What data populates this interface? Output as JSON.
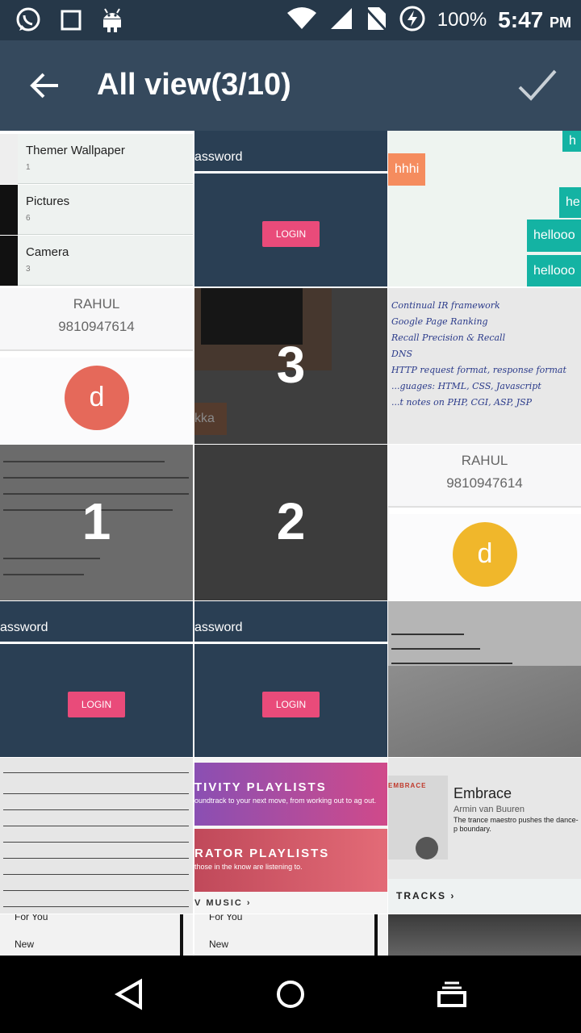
{
  "status_bar": {
    "battery": "100%",
    "time": "5:47",
    "ampm": "PM"
  },
  "app_bar": {
    "title": "All view(3/10)"
  },
  "thumbnails": {
    "folders": [
      {
        "name": "Themer Wallpaper",
        "count": "1"
      },
      {
        "name": "Pictures",
        "count": "6"
      },
      {
        "name": "Camera",
        "count": "3"
      }
    ],
    "password_label": "assword",
    "login_label": "LOGIN",
    "contact_name": "RAHUL",
    "contact_phone": "9810947614",
    "avatar_letter": "d",
    "chat_bubbles": [
      "hhhi",
      "he",
      "hellooo",
      "hellooo",
      "h"
    ],
    "chat_fragment": "kka",
    "note_lines": [
      "Continual IR framework",
      "Google Page Ranking",
      "Recall Precision & Recall",
      "DNS",
      "HTTP request format, response format",
      "...guages: HTML, CSS, Javascript",
      "...t notes on PHP, CGI, ASP, JSP"
    ],
    "selection_numbers": [
      "3",
      "1",
      "2"
    ],
    "music": {
      "band1_title": "TIVITY PLAYLISTS",
      "band1_sub": "oundtrack to your next move, from working out to ag out.",
      "band2_title": "RATOR PLAYLISTS",
      "band2_sub": "those in the know are listening to.",
      "new_music_link": "V MUSIC",
      "embrace_head": "EMBRACE",
      "embrace_title": "Embrace",
      "embrace_artist": "Armin van Buuren",
      "embrace_desc": "The trance maestro pushes the dance-p boundary.",
      "tracks_link": "TRACKS",
      "for_you": "For You",
      "new": "New"
    }
  },
  "icons": {
    "status_left": [
      "whatsapp-icon",
      "square-icon",
      "android-icon"
    ],
    "status_right": [
      "wifi-icon",
      "signal-icon",
      "no-sim-icon",
      "charging-icon"
    ],
    "nav": [
      "back-icon",
      "home-icon",
      "recents-icon"
    ]
  },
  "colors": {
    "app_bar": "#35495d",
    "status_bar": "#263849",
    "avatar_red": "#e5695a",
    "avatar_yellow": "#f0b72b",
    "login_button": "#e94b7a",
    "chat_bubble": "#14b3a3"
  }
}
